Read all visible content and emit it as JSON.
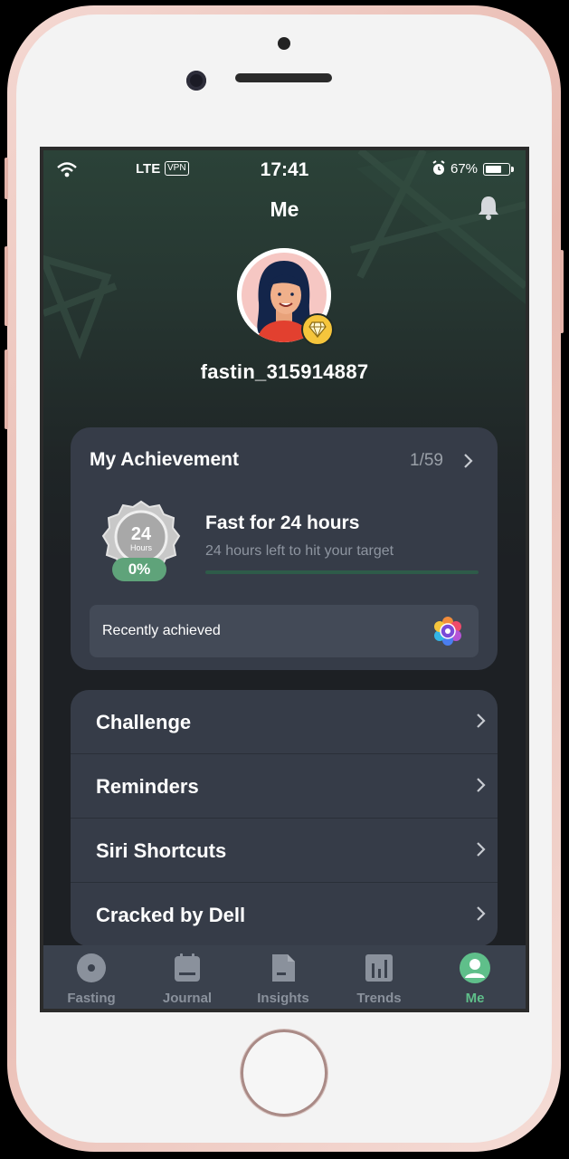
{
  "status_bar": {
    "network": "LTE",
    "vpn": "VPN",
    "time": "17:41",
    "battery": "67%"
  },
  "header": {
    "title": "Me"
  },
  "profile": {
    "username": "fastin_315914887"
  },
  "achievement": {
    "title": "My Achievement",
    "count": "1/59",
    "medal_number": "24",
    "medal_unit": "Hours",
    "medal_percent": "0%",
    "goal_title": "Fast for 24 hours",
    "goal_subtitle": "24 hours left to hit your target",
    "progress": 0.0,
    "recently_achieved_label": "Recently achieved"
  },
  "menu": {
    "items": [
      {
        "label": "Challenge"
      },
      {
        "label": "Reminders"
      },
      {
        "label": "Siri Shortcuts"
      },
      {
        "label": "Cracked by Dell"
      }
    ]
  },
  "tabbar": {
    "tabs": [
      {
        "label": "Fasting",
        "icon": "fasting-icon"
      },
      {
        "label": "Journal",
        "icon": "journal-icon"
      },
      {
        "label": "Insights",
        "icon": "insights-icon"
      },
      {
        "label": "Trends",
        "icon": "trends-icon"
      },
      {
        "label": "Me",
        "icon": "me-icon"
      }
    ],
    "active_tab": "Me"
  },
  "colors": {
    "accent_green": "#5fbf8a",
    "card_background": "#363c48",
    "tab_background": "#3a414d",
    "badge_gold": "#f5c53c"
  }
}
